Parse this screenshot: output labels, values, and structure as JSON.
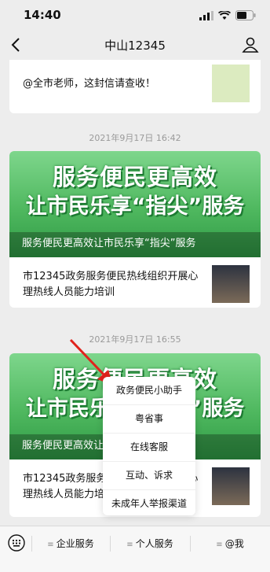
{
  "status": {
    "time": "14:40"
  },
  "nav": {
    "title": "中山12345"
  },
  "card1": {
    "text": "@全市老师，这封信请查收！"
  },
  "msg1": {
    "timestamp": "2021年9月17日 16:42",
    "banner_line1": "服务便民更高效",
    "banner_line2": "让市民乐享“指尖”服务",
    "caption": "服务便民更高效让市民乐享“指尖”服务",
    "sub_text": "市12345政务服务便民热线组织开展心理热线人员能力培训"
  },
  "msg2": {
    "timestamp": "2021年9月17日 16:55",
    "banner_line1": "服务便民更高效",
    "banner_line2": "让市民乐享“指尖”服务",
    "caption": "服务便民更高效让市民乐享“指尖”服务",
    "sub_text": "市12345政务服务便民热线组织开展心理热线人员能力培训"
  },
  "popup_menu": {
    "items": [
      "政务便民小助手",
      "粤省事",
      "在线客服",
      "互动、诉求",
      "未成年人举报渠道"
    ]
  },
  "tabbar": {
    "tabs": [
      "企业服务",
      "个人服务",
      "@我"
    ]
  }
}
